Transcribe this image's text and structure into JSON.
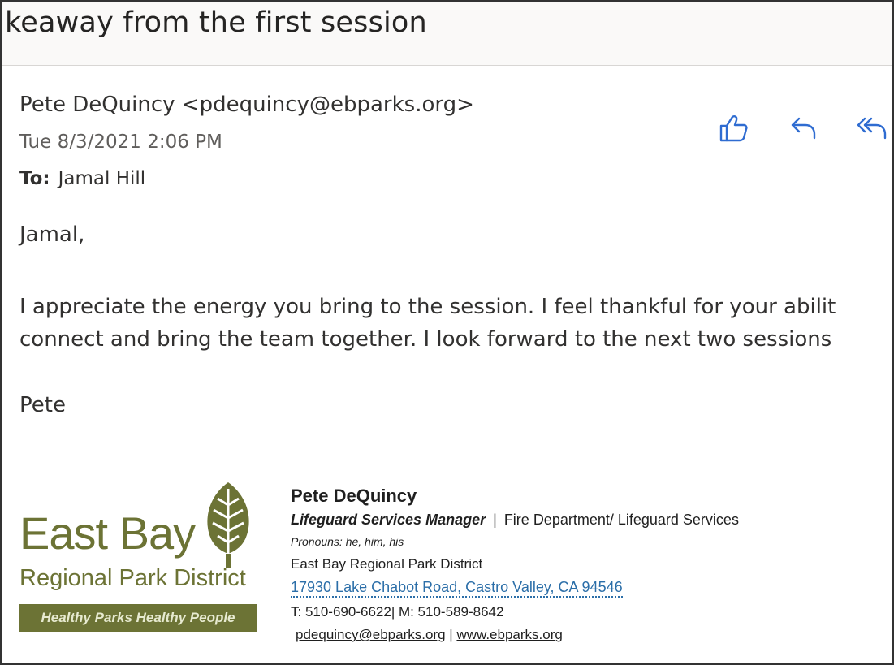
{
  "subject": "keaway from the first session",
  "message": {
    "sender": "Pete DeQuincy <pdequincy@ebparks.org>",
    "date": "Tue 8/3/2021 2:06 PM",
    "to_label": "To:",
    "to_value": "Jamal Hill"
  },
  "actions": [
    {
      "name": "like",
      "icon": "thumbs-up-icon"
    },
    {
      "name": "reply",
      "icon": "reply-icon"
    },
    {
      "name": "reply-all",
      "icon": "reply-all-icon"
    }
  ],
  "body": {
    "greeting": "Jamal,",
    "line1": "I appreciate the energy you bring to the session. I feel thankful for your abilit",
    "line2": "connect and bring the team together. I look forward to the next two sessions",
    "signoff": "Pete"
  },
  "logo": {
    "line1": "East Bay",
    "line2": "Regional Park District",
    "tagline": "Healthy Parks Healthy People",
    "color": "#6c7335"
  },
  "signature": {
    "name": "Pete DeQuincy",
    "title": "Lifeguard Services Manager",
    "separator": "|",
    "department": "Fire Department/ Lifeguard Services",
    "pronouns": "Pronouns: he, him, his",
    "organization": "East Bay Regional Park District",
    "address": "17930 Lake Chabot Road, Castro Valley, CA 94546",
    "phone": "T: 510-690-6622| M: 510-589-8642",
    "email_link": "pdequincy@ebparks.org",
    "links_separator": "|",
    "website_link": "www.ebparks.org"
  },
  "colors": {
    "accent": "#2b6ea8",
    "icon_blue": "#2f6cd1"
  }
}
